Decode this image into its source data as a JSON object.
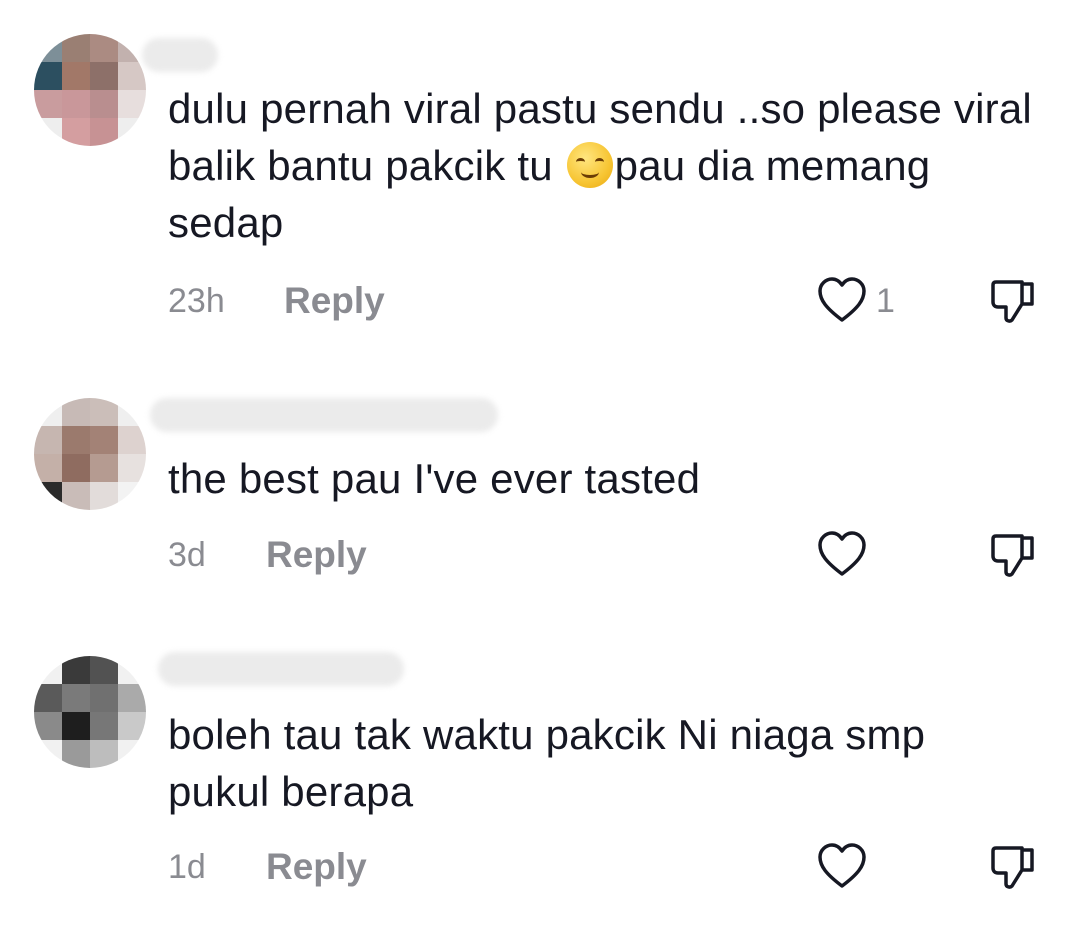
{
  "comments": [
    {
      "text_before_emoji": "dulu pernah viral pastu sendu ..so please viral balik bantu pakcik tu ",
      "emoji": "smiling-face-with-smiling-eyes",
      "text_after_emoji": "pau dia memang sedap",
      "time": "23h",
      "reply_label": "Reply",
      "like_count": "1"
    },
    {
      "text": "the best pau I've ever tasted",
      "time": "3d",
      "reply_label": "Reply",
      "like_count": ""
    },
    {
      "text": "boleh tau tak waktu pakcik Ni niaga smp pukul berapa",
      "time": "1d",
      "reply_label": "Reply",
      "like_count": ""
    }
  ],
  "colors": {
    "text": "#161823",
    "muted": "#8a8b91",
    "background": "#ffffff"
  },
  "icons": [
    "heart-outline-icon",
    "thumbs-down-outline-icon"
  ]
}
